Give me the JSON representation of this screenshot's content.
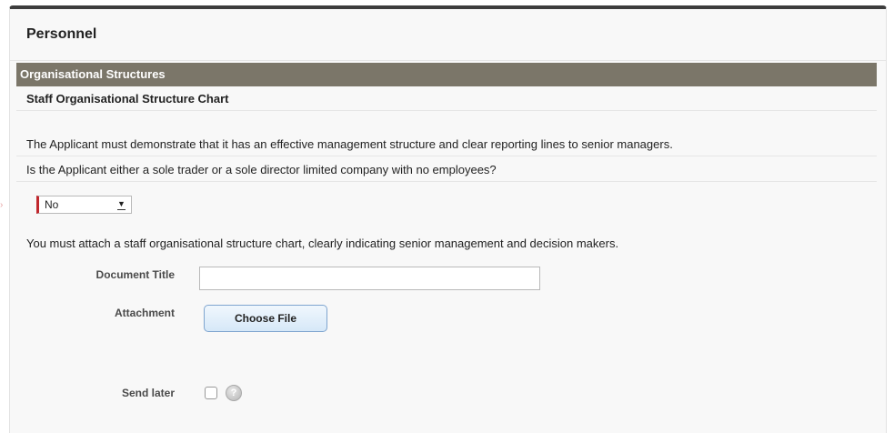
{
  "panel": {
    "title": "Personnel"
  },
  "section": {
    "header": "Organisational Structures",
    "subheading": "Staff Organisational Structure Chart",
    "requirement_text": "The Applicant must demonstrate that it has an effective management structure and clear reporting lines to senior managers.",
    "question": "Is the Applicant either a sole trader or a sole director limited company with no employees?",
    "answer_select": {
      "value": "No",
      "arrow": "▼"
    },
    "attach_instruction": "You must attach a staff organisational structure chart, clearly indicating senior management and decision makers."
  },
  "form": {
    "document_title_label": "Document Title",
    "document_title_value": "",
    "attachment_label": "Attachment",
    "choose_file_label": "Choose File",
    "send_later_label": "Send later",
    "send_later_checked": false,
    "help_glyph": "?"
  },
  "icons": {
    "select_arrow": "chevron-down-icon",
    "help": "help-icon"
  },
  "colors": {
    "section_header_bg": "#7b7669",
    "required_border": "#c0272d",
    "button_border": "#7fa5cf",
    "panel_top_border": "#3d3d3d"
  }
}
